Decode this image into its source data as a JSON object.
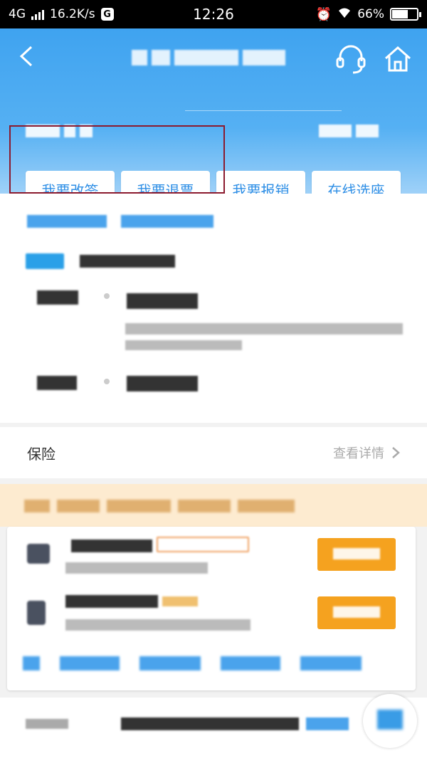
{
  "status_bar": {
    "network": "4G",
    "speed": "16.2K/s",
    "app_badge": "G",
    "time": "12:26",
    "battery": "66%",
    "battery_level": 0.66
  },
  "header": {
    "icons": [
      "back-arrow-icon",
      "headset-support-icon",
      "home-icon"
    ]
  },
  "actions": [
    {
      "label": "我要改签"
    },
    {
      "label": "我要退票"
    },
    {
      "label": "我要报销"
    },
    {
      "label": "在线选座"
    }
  ],
  "insurance": {
    "label": "保险",
    "link": "查看详情"
  },
  "colors": {
    "header_blue": "#3fa3f0",
    "accent_blue": "#2f8fe6",
    "highlight_box": "#8b1a2e",
    "orange": "#f5a21f"
  }
}
